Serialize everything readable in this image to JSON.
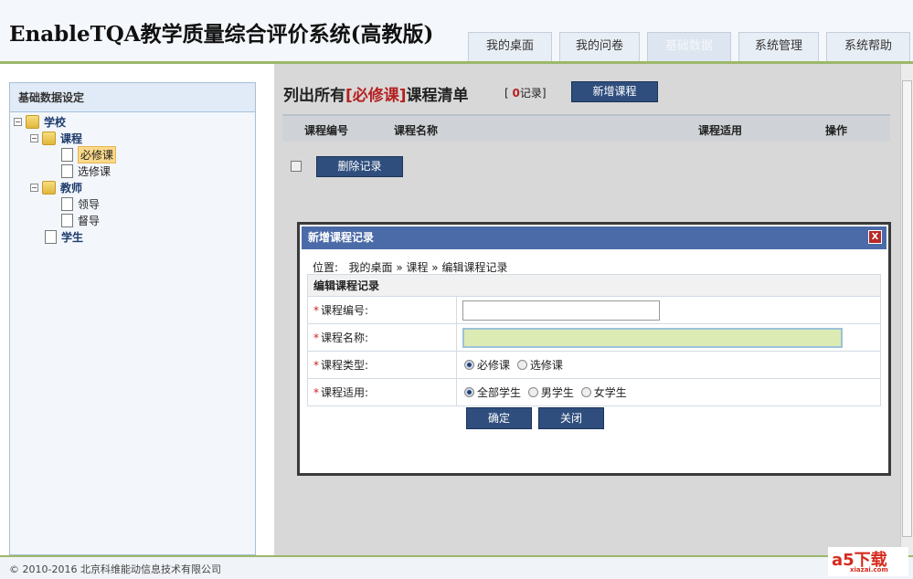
{
  "header": {
    "title": "EnableTQA教学质量综合评价系统(高教版)",
    "tabs": [
      "我的桌面",
      "我的问卷",
      "基础数据",
      "系统管理",
      "系统帮助"
    ],
    "active_tab": "基础数据"
  },
  "sidebar": {
    "title": "基础数据设定",
    "tree": {
      "school": "学校",
      "course": "课程",
      "required": "必修课",
      "elective": "选修课",
      "teacher": "教师",
      "leader": "领导",
      "supervisor": "督导",
      "student": "学生"
    }
  },
  "main": {
    "title_prefix": "列出所有",
    "title_highlight": "[必修课]",
    "title_suffix": "课程清单",
    "count_open": "[",
    "count": "0",
    "count_label": "记录]",
    "add_button": "新增课程",
    "columns": [
      "课程编号",
      "课程名称",
      "课程适用",
      "操作"
    ],
    "delete_button": "删除记录"
  },
  "dialog": {
    "title": "新增课程记录",
    "close": "X",
    "crumb_label": "位置:",
    "crumb": "我的桌面 » 课程 » 编辑课程记录",
    "section": "编辑课程记录",
    "fields": {
      "code_label": "课程编号:",
      "name_label": "课程名称:",
      "type_label": "课程类型:",
      "apply_label": "课程适用:",
      "code_value": "",
      "name_value": ""
    },
    "type_options": [
      "必修课",
      "选修课"
    ],
    "apply_options": [
      "全部学生",
      "男学生",
      "女学生"
    ],
    "ok": "确定",
    "close_button": "关闭"
  },
  "footer": {
    "copyright": "© 2010-2016 北京科维能动信息技术有限公司",
    "logo_text": "a5下载",
    "logo_sub": "xiazai.com"
  }
}
